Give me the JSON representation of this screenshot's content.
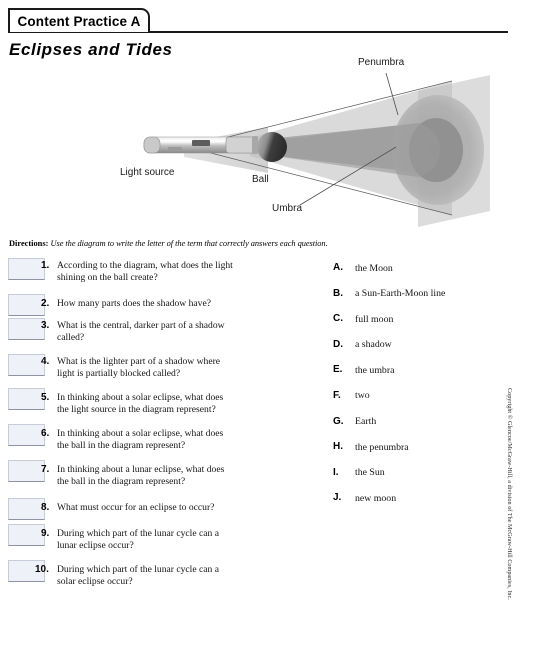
{
  "header": {
    "tab_label": "Content Practice A",
    "worksheet_title": "Eclipses and Tides"
  },
  "diagram": {
    "labels": {
      "penumbra": "Penumbra",
      "light_source": "Light source",
      "ball": "Ball",
      "umbra": "Umbra"
    },
    "colors": {
      "screen": "#d9d9d9",
      "penumbra_circle": "#b3b3b3",
      "umbra_circle": "#999999",
      "beam": "#c8c8c8",
      "shadow_cone": "#a8a8a8",
      "ball_dark": "#4a4a4a",
      "ball_light": "#9a9a9a",
      "leader_line": "#555555"
    }
  },
  "directions": {
    "label": "Directions:",
    "text": "Use the diagram to write the letter of the term that correctly answers each question."
  },
  "questions": [
    {
      "number": "1.",
      "lines": [
        "According to the diagram, what does the light",
        "shining  on the ball create?"
      ]
    },
    {
      "number": "2.",
      "lines": [
        "How many parts does the shadow have?"
      ]
    },
    {
      "number": "3.",
      "lines": [
        "What is  the central, darker part of a shadow",
        "called?"
      ]
    },
    {
      "number": "4.",
      "lines": [
        "What is  the lighter  part of a shadow  where",
        "light  is partially  blocked called?"
      ]
    },
    {
      "number": "5.",
      "lines": [
        "In thinking  about a solar eclipse, what does",
        "the light  source in the diagram represent?"
      ]
    },
    {
      "number": "6.",
      "lines": [
        "In thinking  about a solar eclipse, what does",
        "the ball in the diagram represent?"
      ]
    },
    {
      "number": "7.",
      "lines": [
        "In thinking  about a lunar eclipse, what does",
        "the ball in the diagram represent?"
      ]
    },
    {
      "number": "8.",
      "lines": [
        "What must occur for an eclipse  to occur?"
      ]
    },
    {
      "number": "9.",
      "lines": [
        "During which part of the lunar cycle can a",
        "lunar eclipse occur?"
      ]
    },
    {
      "number": "10.",
      "lines": [
        "During which part of the lunar cycle can a",
        "solar eclipse occur?"
      ]
    }
  ],
  "options": [
    {
      "letter": "A.",
      "text": "the Moon"
    },
    {
      "letter": "B.",
      "text": "a Sun-Earth-Moon line"
    },
    {
      "letter": "C.",
      "text": "full moon"
    },
    {
      "letter": "D.",
      "text": "a shadow"
    },
    {
      "letter": "E.",
      "text": "the umbra"
    },
    {
      "letter": "F.",
      "text": "two"
    },
    {
      "letter": "G.",
      "text": "Earth"
    },
    {
      "letter": "H.",
      "text": "the penumbra"
    },
    {
      "letter": "I.",
      "text": "the Sun"
    },
    {
      "letter": "J.",
      "text": "new moon"
    }
  ],
  "copyright": "Copyright © Glencoe/McGraw-Hill, a division of The McGraw-Hill Companies, Inc."
}
